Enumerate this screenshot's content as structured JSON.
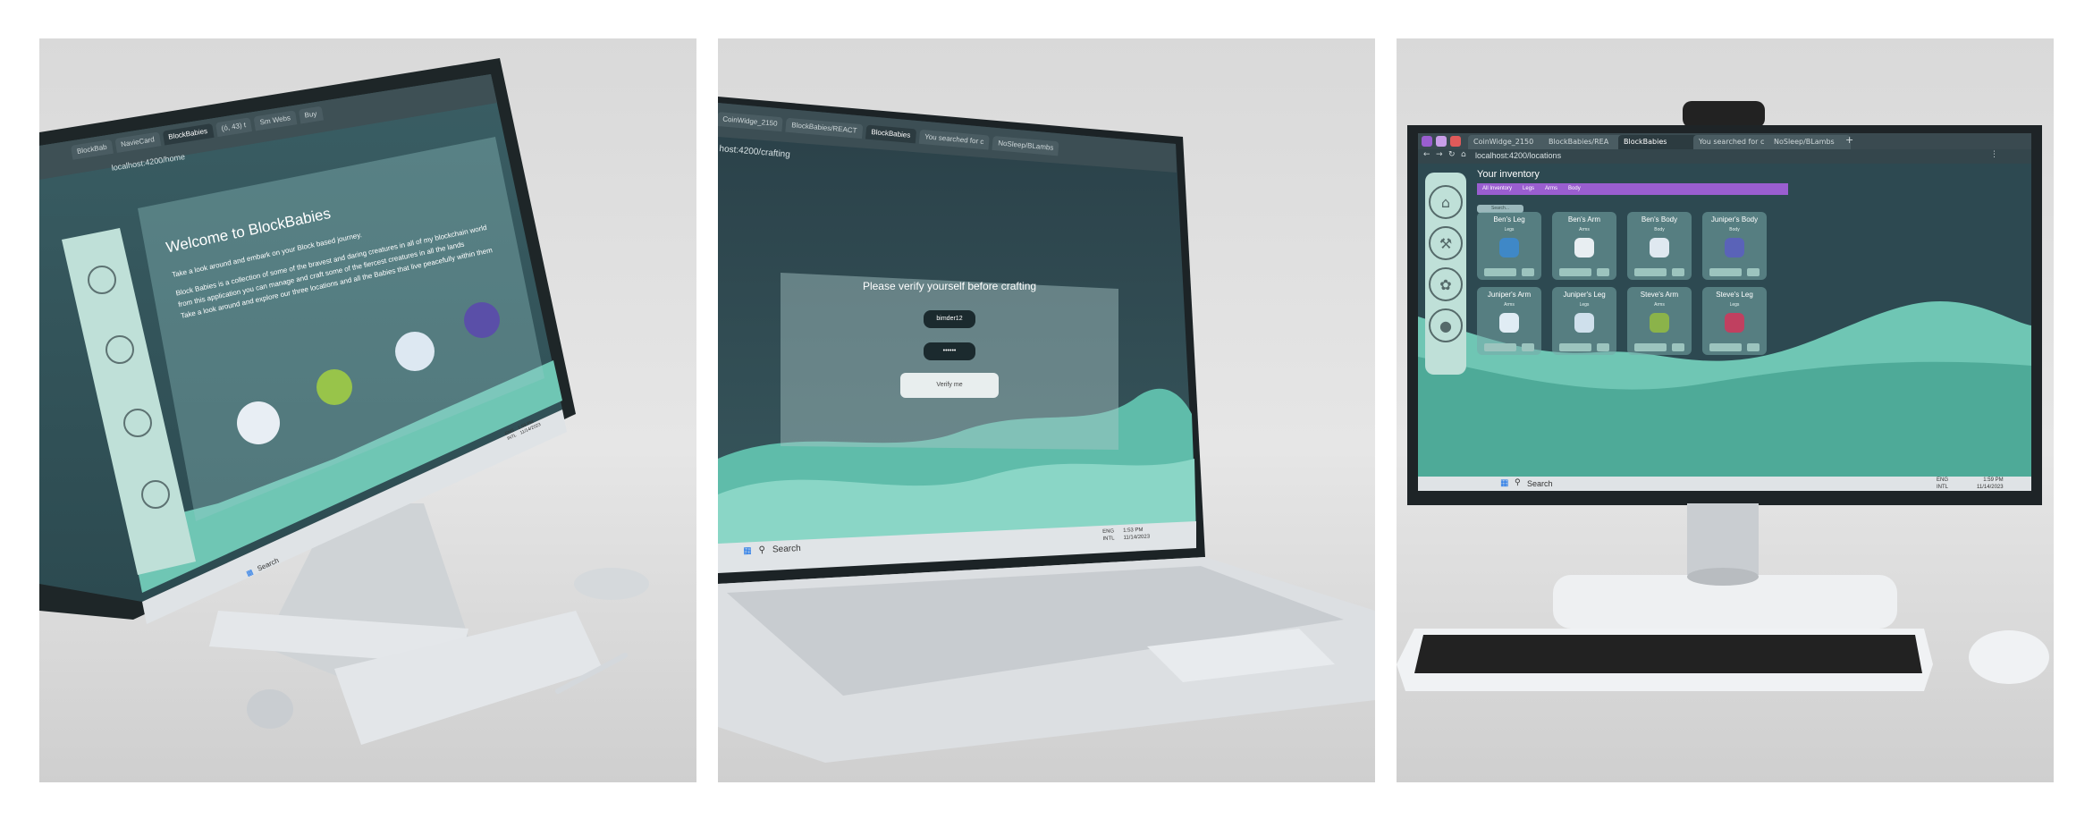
{
  "panel1": {
    "tabs": [
      "BlockBab",
      "NavieCard",
      "BlockBabies",
      "(ó, 43) t",
      "Sm Webs",
      "Buy"
    ],
    "url": "localhost:4200/home",
    "welcome_title": "Welcome to BlockBabies",
    "welcome_text": [
      "Take a look around and embark on your Block based journey.",
      "Block Babies is a collection of some of the bravest and daring creatures in all of my blockchain world",
      "from this application you can manage and craft some of the fiercest creatures in all the lands",
      "Take a look around and explore our three locations and all the Babies that live peacefully within them"
    ],
    "taskbar": {
      "search": "Search",
      "lang": [
        "ENG",
        "INTL"
      ],
      "time": "1:59 PM",
      "date": "11/14/2023"
    }
  },
  "panel2": {
    "tabs": [
      "CoinWidge_2150",
      "BlockBabies/REACT",
      "BlockBabies",
      "You searched for c",
      "NoSleep/BLambs"
    ],
    "url": "host:4200/crafting",
    "verify_title": "Please verify yourself before crafting",
    "username_value": "bimder12",
    "password_value": "••••••",
    "verify_button": "Verify me",
    "taskbar": {
      "search": "Search",
      "lang": [
        "ENG",
        "INTL"
      ],
      "time": "1:53 PM",
      "date": "11/14/2023"
    }
  },
  "panel3": {
    "tabs": [
      "CoinWidge_2150",
      "BlockBabies/REA",
      "BlockBabies",
      "You searched for c",
      "NoSleep/BLambs"
    ],
    "url": "localhost:4200/locations",
    "inventory_title": "Your inventory",
    "filter_tabs": [
      "All Inventory",
      "Legs",
      "Arms",
      "Body"
    ],
    "search_placeholder": "Search...",
    "cards": [
      {
        "name": "Ben's Leg",
        "category": "Legs",
        "color": "#3f88c7"
      },
      {
        "name": "Ben's Arm",
        "category": "Arms",
        "color": "#e8eef2"
      },
      {
        "name": "Ben's Body",
        "category": "Body",
        "color": "#dfe8f0"
      },
      {
        "name": "Juniper's Body",
        "category": "Body",
        "color": "#5a63b8"
      },
      {
        "name": "Juniper's Arm",
        "category": "Arms",
        "color": "#e0ecf4"
      },
      {
        "name": "Juniper's Leg",
        "category": "Legs",
        "color": "#cfe0ec"
      },
      {
        "name": "Steve's Arm",
        "category": "Arms",
        "color": "#8bb34a"
      },
      {
        "name": "Steve's Leg",
        "category": "Legs",
        "color": "#c04060"
      }
    ],
    "taskbar": {
      "search": "Search",
      "lang": [
        "ENG",
        "INTL"
      ],
      "time": "1:59 PM",
      "date": "11/14/2023"
    }
  },
  "colors": {
    "app_bg": "#2f4a52",
    "wave_light": "#7fd1c0",
    "wave_mid": "#5fbcaa",
    "accent_purple": "#9a5ed0",
    "sidebar": "#bfe0d8"
  }
}
